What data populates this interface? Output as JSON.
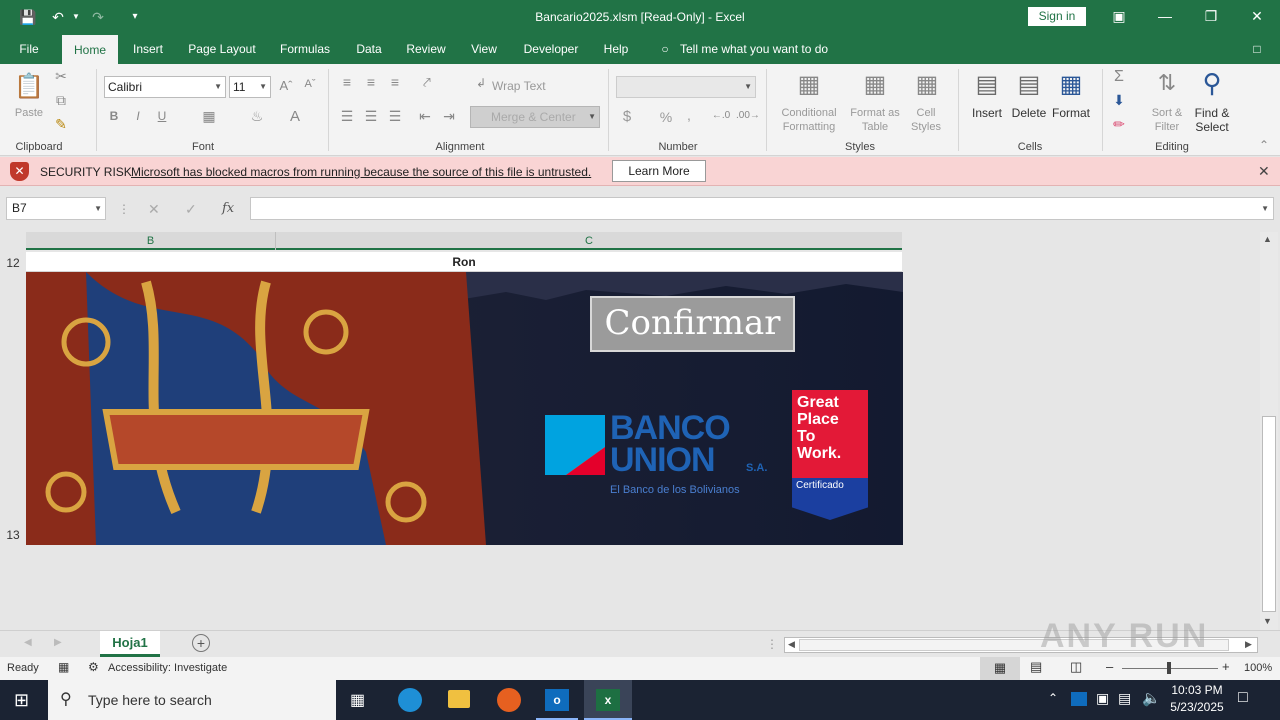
{
  "window": {
    "title": "Bancario2025.xlsm  [Read-Only]  -  Excel",
    "signin": "Sign in"
  },
  "tabs": [
    "File",
    "Home",
    "Insert",
    "Page Layout",
    "Formulas",
    "Data",
    "Review",
    "View",
    "Developer",
    "Help"
  ],
  "tell_me": "Tell me what you want to do",
  "ribbon": {
    "clipboard": {
      "label": "Clipboard",
      "paste": "Paste"
    },
    "font": {
      "label": "Font",
      "name": "Calibri",
      "size": "11"
    },
    "alignment": {
      "label": "Alignment",
      "wrap": "Wrap Text",
      "merge": "Merge & Center"
    },
    "number": {
      "label": "Number",
      "currency": "$",
      "percent": "%",
      "comma": ","
    },
    "styles": {
      "label": "Styles",
      "cond1": "Conditional",
      "cond2": "Formatting",
      "fmt1": "Format as",
      "fmt2": "Table",
      "cell1": "Cell",
      "cell2": "Styles"
    },
    "cells": {
      "label": "Cells",
      "insert": "Insert",
      "delete": "Delete",
      "format": "Format"
    },
    "editing": {
      "label": "Editing",
      "sort1": "Sort &",
      "sort2": "Filter",
      "find1": "Find &",
      "find2": "Select"
    }
  },
  "security": {
    "title": "SECURITY RISK",
    "message": "Microsoft has blocked macros from running because the source of this file is untrusted.",
    "button": "Learn More"
  },
  "formula": {
    "namebox": "B7",
    "fx": "fx"
  },
  "columns": [
    "B",
    "C"
  ],
  "rows": [
    "12",
    "13"
  ],
  "cells": {
    "c12": "Ron"
  },
  "banner": {
    "button": "Confirmar",
    "bank1": "BANCO",
    "bank2": "UNION",
    "bank_sa": "S.A.",
    "bank_tag": "El Banco de los Bolivianos",
    "gptw1": "Great",
    "gptw2": "Place",
    "gptw3": "To",
    "gptw4": "Work.",
    "gptw5": "Certificado"
  },
  "sheet_tab": "Hoja1",
  "status": {
    "ready": "Ready",
    "accessibility": "Accessibility: Investigate",
    "zoom": "100%"
  },
  "taskbar": {
    "search": "Type here to search",
    "time": "10:03 PM",
    "date": "5/23/2025"
  },
  "watermark": "ANY RUN",
  "colors": {
    "excel_green": "#217346",
    "security_bg": "#f9d4d4",
    "banner_bg": "#141a2e"
  }
}
